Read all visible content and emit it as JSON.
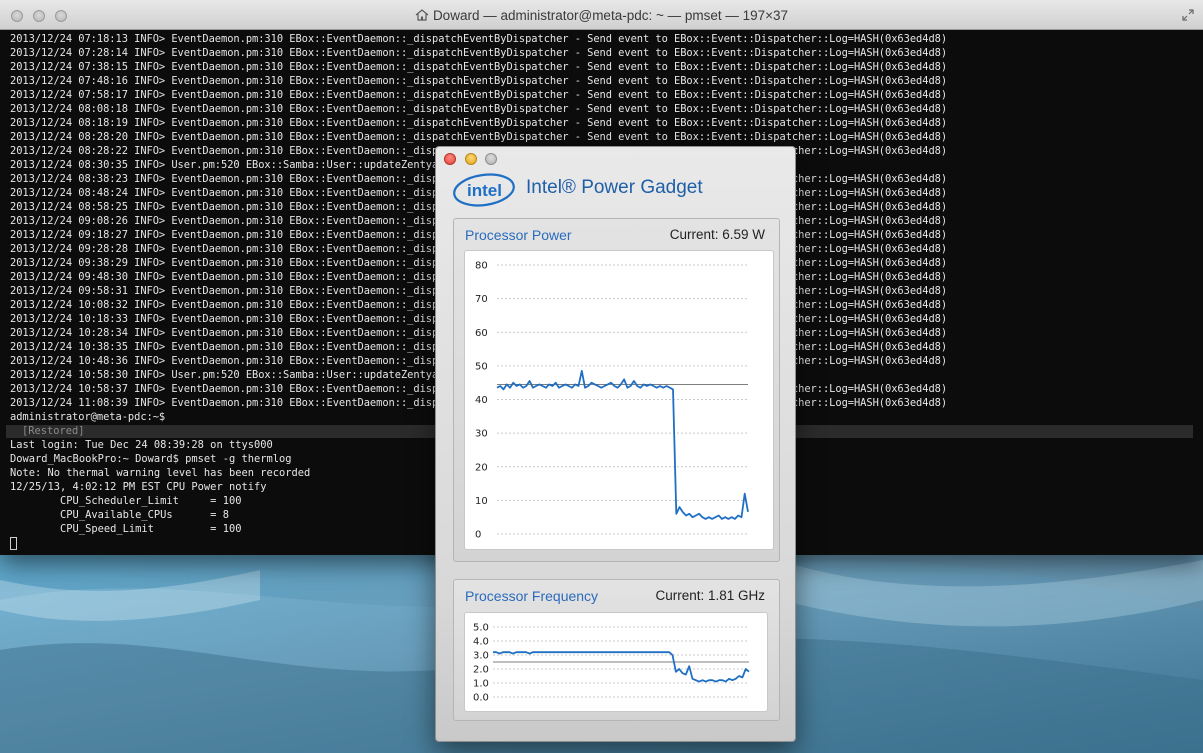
{
  "terminal": {
    "title": "Doward — administrator@meta-pdc: ~ — pmset — 197×37",
    "log_lines": [
      "2013/12/24 07:18:13 INFO> EventDaemon.pm:310 EBox::EventDaemon::_dispatchEventByDispatcher - Send event to EBox::Event::Dispatcher::Log=HASH(0x63ed4d8)",
      "2013/12/24 07:28:14 INFO> EventDaemon.pm:310 EBox::EventDaemon::_dispatchEventByDispatcher - Send event to EBox::Event::Dispatcher::Log=HASH(0x63ed4d8)",
      "2013/12/24 07:38:15 INFO> EventDaemon.pm:310 EBox::EventDaemon::_dispatchEventByDispatcher - Send event to EBox::Event::Dispatcher::Log=HASH(0x63ed4d8)",
      "2013/12/24 07:48:16 INFO> EventDaemon.pm:310 EBox::EventDaemon::_dispatchEventByDispatcher - Send event to EBox::Event::Dispatcher::Log=HASH(0x63ed4d8)",
      "2013/12/24 07:58:17 INFO> EventDaemon.pm:310 EBox::EventDaemon::_dispatchEventByDispatcher - Send event to EBox::Event::Dispatcher::Log=HASH(0x63ed4d8)",
      "2013/12/24 08:08:18 INFO> EventDaemon.pm:310 EBox::EventDaemon::_dispatchEventByDispatcher - Send event to EBox::Event::Dispatcher::Log=HASH(0x63ed4d8)",
      "2013/12/24 08:18:19 INFO> EventDaemon.pm:310 EBox::EventDaemon::_dispatchEventByDispatcher - Send event to EBox::Event::Dispatcher::Log=HASH(0x63ed4d8)",
      "2013/12/24 08:28:20 INFO> EventDaemon.pm:310 EBox::EventDaemon::_dispatchEventByDispatcher - Send event to EBox::Event::Dispatcher::Log=HASH(0x63ed4d8)",
      "2013/12/24 08:28:22 INFO> EventDaemon.pm:310 EBox::EventDaemon::_dispatchEventByDispatcher - Send event to EBox::Event::Dispatcher::Log=HASH(0x63ed4d8)",
      "2013/12/24 08:30:35 INFO> User.pm:520 EBox::Samba::User::updateZentyal",
      "2013/12/24 08:38:23 INFO> EventDaemon.pm:310 EBox::EventDaemon::_dispatchEventByDispatcher - Send event to EBox::Event::Dispatcher::Log=HASH(0x63ed4d8)",
      "2013/12/24 08:48:24 INFO> EventDaemon.pm:310 EBox::EventDaemon::_dispatchEventByDispatcher - Send event to EBox::Event::Dispatcher::Log=HASH(0x63ed4d8)",
      "2013/12/24 08:58:25 INFO> EventDaemon.pm:310 EBox::EventDaemon::_dispatchEventByDispatcher - Send event to EBox::Event::Dispatcher::Log=HASH(0x63ed4d8)",
      "2013/12/24 09:08:26 INFO> EventDaemon.pm:310 EBox::EventDaemon::_dispatchEventByDispatcher - Send event to EBox::Event::Dispatcher::Log=HASH(0x63ed4d8)",
      "2013/12/24 09:18:27 INFO> EventDaemon.pm:310 EBox::EventDaemon::_dispatchEventByDispatcher - Send event to EBox::Event::Dispatcher::Log=HASH(0x63ed4d8)",
      "2013/12/24 09:28:28 INFO> EventDaemon.pm:310 EBox::EventDaemon::_dispatchEventByDispatcher - Send event to EBox::Event::Dispatcher::Log=HASH(0x63ed4d8)",
      "2013/12/24 09:38:29 INFO> EventDaemon.pm:310 EBox::EventDaemon::_dispatchEventByDispatcher - Send event to EBox::Event::Dispatcher::Log=HASH(0x63ed4d8)",
      "2013/12/24 09:48:30 INFO> EventDaemon.pm:310 EBox::EventDaemon::_dispatchEventByDispatcher - Send event to EBox::Event::Dispatcher::Log=HASH(0x63ed4d8)",
      "2013/12/24 09:58:31 INFO> EventDaemon.pm:310 EBox::EventDaemon::_dispatchEventByDispatcher - Send event to EBox::Event::Dispatcher::Log=HASH(0x63ed4d8)",
      "2013/12/24 10:08:32 INFO> EventDaemon.pm:310 EBox::EventDaemon::_dispatchEventByDispatcher - Send event to EBox::Event::Dispatcher::Log=HASH(0x63ed4d8)",
      "2013/12/24 10:18:33 INFO> EventDaemon.pm:310 EBox::EventDaemon::_dispatchEventByDispatcher - Send event to EBox::Event::Dispatcher::Log=HASH(0x63ed4d8)",
      "2013/12/24 10:28:34 INFO> EventDaemon.pm:310 EBox::EventDaemon::_dispatchEventByDispatcher - Send event to EBox::Event::Dispatcher::Log=HASH(0x63ed4d8)",
      "2013/12/24 10:38:35 INFO> EventDaemon.pm:310 EBox::EventDaemon::_dispatchEventByDispatcher - Send event to EBox::Event::Dispatcher::Log=HASH(0x63ed4d8)",
      "2013/12/24 10:48:36 INFO> EventDaemon.pm:310 EBox::EventDaemon::_dispatchEventByDispatcher - Send event to EBox::Event::Dispatcher::Log=HASH(0x63ed4d8)",
      "2013/12/24 10:58:30 INFO> User.pm:520 EBox::Samba::User::updateZentyal",
      "2013/12/24 10:58:37 INFO> EventDaemon.pm:310 EBox::EventDaemon::_dispatchEventByDispatcher - Send event to EBox::Event::Dispatcher::Log=HASH(0x63ed4d8)",
      "2013/12/24 11:08:39 INFO> EventDaemon.pm:310 EBox::EventDaemon::_dispatchEventByDispatcher - Send event to EBox::Event::Dispatcher::Log=HASH(0x63ed4d8)",
      "administrator@meta-pdc:~$"
    ],
    "restored_label": "[Restored]",
    "session_lines": [
      "Last login: Tue Dec 24 08:39:28 on ttys000",
      "Doward_MacBookPro:~ Doward$ pmset -g thermlog",
      "Note: No thermal warning level has been recorded",
      "12/25/13, 4:02:12 PM EST CPU Power notify",
      "        CPU_Scheduler_Limit     = 100",
      "        CPU_Available_CPUs      = 8",
      "        CPU_Speed_Limit         = 100"
    ]
  },
  "gadget": {
    "logo_text": "intel",
    "title": "Intel® Power Gadget",
    "power": {
      "label": "Processor Power",
      "current": "Current: 6.59 W"
    },
    "frequency": {
      "label": "Processor Frequency",
      "current": "Current: 1.81 GHz"
    }
  },
  "colors": {
    "accent": "#1f6fc4",
    "label_blue": "#2a6bbd",
    "terminal_bg": "#0c0c0c"
  },
  "chart_data": [
    {
      "type": "line",
      "title": "Processor Power",
      "ylim": [
        0,
        80
      ],
      "yticks": [
        "0",
        "10",
        "20",
        "30",
        "40",
        "50",
        "60",
        "70",
        "80"
      ],
      "reference_line": 44.5,
      "series": [
        {
          "values": [
            43.5,
            44,
            43,
            44.5,
            43.5,
            45,
            44,
            44.5,
            43.5,
            44,
            45.5,
            43.5,
            44,
            44.5,
            44,
            43.5,
            44.5,
            44,
            45,
            43.5,
            44,
            44.5,
            44,
            43.5,
            44.5,
            44,
            48.5,
            43.5,
            44,
            45,
            44.5,
            44,
            43.5,
            44,
            44.5,
            45,
            44,
            43.5,
            44.5,
            46,
            43.5,
            44,
            45.5,
            44,
            43.5,
            44.5,
            44,
            44.5,
            44,
            43.5,
            44,
            43.5,
            44,
            43.5,
            43,
            6,
            8,
            6.5,
            5.5,
            6,
            5,
            5.5,
            6,
            5,
            4.5,
            5,
            4.5,
            5,
            5.5,
            4.5,
            5,
            4.5,
            5,
            4.5,
            5.5,
            5,
            12,
            6.6
          ]
        }
      ]
    },
    {
      "type": "line",
      "title": "Processor Frequency",
      "ylim": [
        0,
        5
      ],
      "yticks": [
        "0.0",
        "1.0",
        "2.0",
        "3.0",
        "4.0",
        "5.0"
      ],
      "reference_line": 2.5,
      "series": [
        {
          "values": [
            3.2,
            3.2,
            3.1,
            3.2,
            3.2,
            3.2,
            3.1,
            3.2,
            3.2,
            3.2,
            3.2,
            3.1,
            3.2,
            3.2,
            3.2,
            3.2,
            3.2,
            3.2,
            3.2,
            3.2,
            3.2,
            3.2,
            3.2,
            3.2,
            3.2,
            3.2,
            3.2,
            3.2,
            3.2,
            3.2,
            3.2,
            3.2,
            3.2,
            3.2,
            3.2,
            3.2,
            3.2,
            3.2,
            3.2,
            3.2,
            3.2,
            3.2,
            3.2,
            3.2,
            3.2,
            3.2,
            3.2,
            3.2,
            3.2,
            3.2,
            3.2,
            3.2,
            3.2,
            3.2,
            3.0,
            1.8,
            2.0,
            1.7,
            1.6,
            2.2,
            1.3,
            1.2,
            1.1,
            1.2,
            1.1,
            1.2,
            1.2,
            1.1,
            1.2,
            1.2,
            1.1,
            1.3,
            1.2,
            1.3,
            1.5,
            1.4,
            2.0,
            1.81
          ]
        }
      ]
    }
  ]
}
